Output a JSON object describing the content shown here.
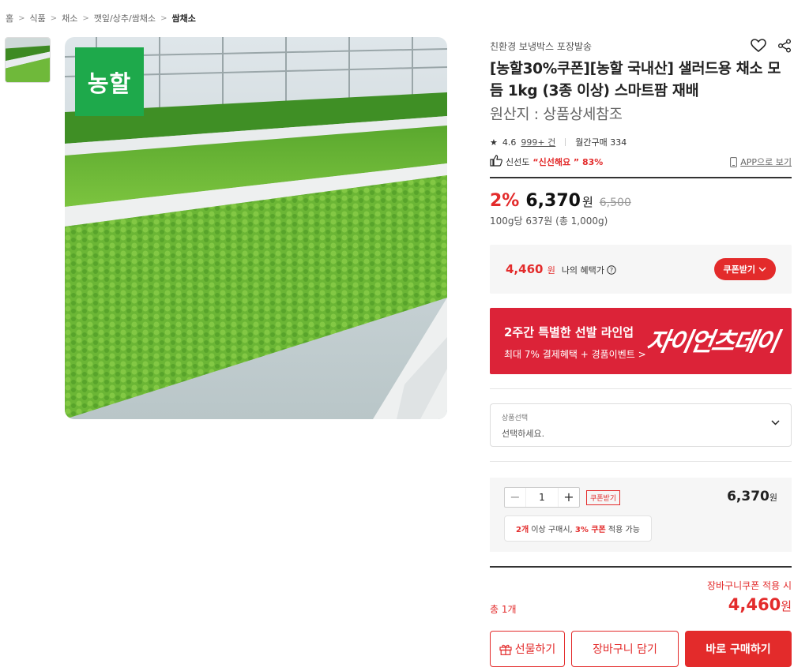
{
  "breadcrumb": {
    "items": [
      "홈",
      "식품",
      "채소",
      "깻잎/상추/쌈채소"
    ],
    "current": "쌈채소",
    "separator": ">"
  },
  "image": {
    "badge_text": "농할"
  },
  "product": {
    "seller_note": "친환경 보냉박스 포장발송",
    "title": "[농할30%쿠폰][농할 국내산] 샐러드용 채소 모듬 1kg (3종 이상) 스마트팜 재배",
    "origin": "원산지 : 상품상세참조",
    "rating": "4.6",
    "review_count": "999+ 건",
    "monthly_purchase": "월간구매 334",
    "freshness_label": "신선도",
    "freshness_value": "“신선해요 ” 83%",
    "app_link": "APP으로 보기"
  },
  "pricing": {
    "discount": "2%",
    "price": "6,370",
    "won": "원",
    "original": "6,500",
    "unit_price": "100g당 637원 (총 1,000g)",
    "benefit_price": "4,460",
    "benefit_label": "나의 혜택가",
    "coupon_button": "쿠폰받기"
  },
  "banner": {
    "title": "2주간 특별한 선발 라인업",
    "subtitle": "최대 7% 결제혜택 + 경품이벤트 >",
    "logo": "자이언츠데이"
  },
  "option_select": {
    "label": "상품선택",
    "value": "선택하세요."
  },
  "quantity": {
    "minus": "−",
    "value": "1",
    "plus": "+",
    "coupon": "쿠폰받기",
    "line_price": "6,370",
    "tip_prefix": "2개",
    "tip_mid": " 이상 구매시, ",
    "tip_highlight": "3% 쿠폰",
    "tip_suffix": " 적용 가능"
  },
  "total": {
    "count": "총 1개",
    "note": "장바구니쿠폰 적용 시",
    "price": "4,460",
    "won": "원"
  },
  "actions": {
    "gift": "선물하기",
    "cart": "장바구니 담기",
    "buy": "바로 구매하기"
  },
  "colors": {
    "accent": "#e32b2b",
    "badge_green": "#1ea94b",
    "banner": "#dc2338"
  }
}
